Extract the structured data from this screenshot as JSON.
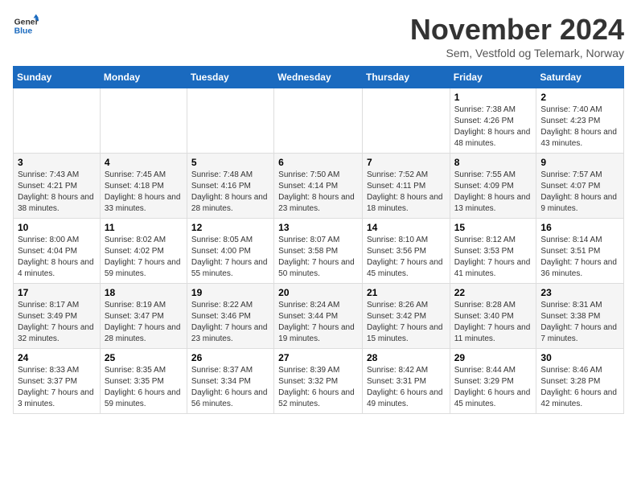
{
  "header": {
    "logo_general": "General",
    "logo_blue": "Blue",
    "month_title": "November 2024",
    "subtitle": "Sem, Vestfold og Telemark, Norway"
  },
  "weekdays": [
    "Sunday",
    "Monday",
    "Tuesday",
    "Wednesday",
    "Thursday",
    "Friday",
    "Saturday"
  ],
  "weeks": [
    [
      {
        "day": "",
        "sunrise": "",
        "sunset": "",
        "daylight": ""
      },
      {
        "day": "",
        "sunrise": "",
        "sunset": "",
        "daylight": ""
      },
      {
        "day": "",
        "sunrise": "",
        "sunset": "",
        "daylight": ""
      },
      {
        "day": "",
        "sunrise": "",
        "sunset": "",
        "daylight": ""
      },
      {
        "day": "",
        "sunrise": "",
        "sunset": "",
        "daylight": ""
      },
      {
        "day": "1",
        "sunrise": "Sunrise: 7:38 AM",
        "sunset": "Sunset: 4:26 PM",
        "daylight": "Daylight: 8 hours and 48 minutes."
      },
      {
        "day": "2",
        "sunrise": "Sunrise: 7:40 AM",
        "sunset": "Sunset: 4:23 PM",
        "daylight": "Daylight: 8 hours and 43 minutes."
      }
    ],
    [
      {
        "day": "3",
        "sunrise": "Sunrise: 7:43 AM",
        "sunset": "Sunset: 4:21 PM",
        "daylight": "Daylight: 8 hours and 38 minutes."
      },
      {
        "day": "4",
        "sunrise": "Sunrise: 7:45 AM",
        "sunset": "Sunset: 4:18 PM",
        "daylight": "Daylight: 8 hours and 33 minutes."
      },
      {
        "day": "5",
        "sunrise": "Sunrise: 7:48 AM",
        "sunset": "Sunset: 4:16 PM",
        "daylight": "Daylight: 8 hours and 28 minutes."
      },
      {
        "day": "6",
        "sunrise": "Sunrise: 7:50 AM",
        "sunset": "Sunset: 4:14 PM",
        "daylight": "Daylight: 8 hours and 23 minutes."
      },
      {
        "day": "7",
        "sunrise": "Sunrise: 7:52 AM",
        "sunset": "Sunset: 4:11 PM",
        "daylight": "Daylight: 8 hours and 18 minutes."
      },
      {
        "day": "8",
        "sunrise": "Sunrise: 7:55 AM",
        "sunset": "Sunset: 4:09 PM",
        "daylight": "Daylight: 8 hours and 13 minutes."
      },
      {
        "day": "9",
        "sunrise": "Sunrise: 7:57 AM",
        "sunset": "Sunset: 4:07 PM",
        "daylight": "Daylight: 8 hours and 9 minutes."
      }
    ],
    [
      {
        "day": "10",
        "sunrise": "Sunrise: 8:00 AM",
        "sunset": "Sunset: 4:04 PM",
        "daylight": "Daylight: 8 hours and 4 minutes."
      },
      {
        "day": "11",
        "sunrise": "Sunrise: 8:02 AM",
        "sunset": "Sunset: 4:02 PM",
        "daylight": "Daylight: 7 hours and 59 minutes."
      },
      {
        "day": "12",
        "sunrise": "Sunrise: 8:05 AM",
        "sunset": "Sunset: 4:00 PM",
        "daylight": "Daylight: 7 hours and 55 minutes."
      },
      {
        "day": "13",
        "sunrise": "Sunrise: 8:07 AM",
        "sunset": "Sunset: 3:58 PM",
        "daylight": "Daylight: 7 hours and 50 minutes."
      },
      {
        "day": "14",
        "sunrise": "Sunrise: 8:10 AM",
        "sunset": "Sunset: 3:56 PM",
        "daylight": "Daylight: 7 hours and 45 minutes."
      },
      {
        "day": "15",
        "sunrise": "Sunrise: 8:12 AM",
        "sunset": "Sunset: 3:53 PM",
        "daylight": "Daylight: 7 hours and 41 minutes."
      },
      {
        "day": "16",
        "sunrise": "Sunrise: 8:14 AM",
        "sunset": "Sunset: 3:51 PM",
        "daylight": "Daylight: 7 hours and 36 minutes."
      }
    ],
    [
      {
        "day": "17",
        "sunrise": "Sunrise: 8:17 AM",
        "sunset": "Sunset: 3:49 PM",
        "daylight": "Daylight: 7 hours and 32 minutes."
      },
      {
        "day": "18",
        "sunrise": "Sunrise: 8:19 AM",
        "sunset": "Sunset: 3:47 PM",
        "daylight": "Daylight: 7 hours and 28 minutes."
      },
      {
        "day": "19",
        "sunrise": "Sunrise: 8:22 AM",
        "sunset": "Sunset: 3:46 PM",
        "daylight": "Daylight: 7 hours and 23 minutes."
      },
      {
        "day": "20",
        "sunrise": "Sunrise: 8:24 AM",
        "sunset": "Sunset: 3:44 PM",
        "daylight": "Daylight: 7 hours and 19 minutes."
      },
      {
        "day": "21",
        "sunrise": "Sunrise: 8:26 AM",
        "sunset": "Sunset: 3:42 PM",
        "daylight": "Daylight: 7 hours and 15 minutes."
      },
      {
        "day": "22",
        "sunrise": "Sunrise: 8:28 AM",
        "sunset": "Sunset: 3:40 PM",
        "daylight": "Daylight: 7 hours and 11 minutes."
      },
      {
        "day": "23",
        "sunrise": "Sunrise: 8:31 AM",
        "sunset": "Sunset: 3:38 PM",
        "daylight": "Daylight: 7 hours and 7 minutes."
      }
    ],
    [
      {
        "day": "24",
        "sunrise": "Sunrise: 8:33 AM",
        "sunset": "Sunset: 3:37 PM",
        "daylight": "Daylight: 7 hours and 3 minutes."
      },
      {
        "day": "25",
        "sunrise": "Sunrise: 8:35 AM",
        "sunset": "Sunset: 3:35 PM",
        "daylight": "Daylight: 6 hours and 59 minutes."
      },
      {
        "day": "26",
        "sunrise": "Sunrise: 8:37 AM",
        "sunset": "Sunset: 3:34 PM",
        "daylight": "Daylight: 6 hours and 56 minutes."
      },
      {
        "day": "27",
        "sunrise": "Sunrise: 8:39 AM",
        "sunset": "Sunset: 3:32 PM",
        "daylight": "Daylight: 6 hours and 52 minutes."
      },
      {
        "day": "28",
        "sunrise": "Sunrise: 8:42 AM",
        "sunset": "Sunset: 3:31 PM",
        "daylight": "Daylight: 6 hours and 49 minutes."
      },
      {
        "day": "29",
        "sunrise": "Sunrise: 8:44 AM",
        "sunset": "Sunset: 3:29 PM",
        "daylight": "Daylight: 6 hours and 45 minutes."
      },
      {
        "day": "30",
        "sunrise": "Sunrise: 8:46 AM",
        "sunset": "Sunset: 3:28 PM",
        "daylight": "Daylight: 6 hours and 42 minutes."
      }
    ]
  ]
}
